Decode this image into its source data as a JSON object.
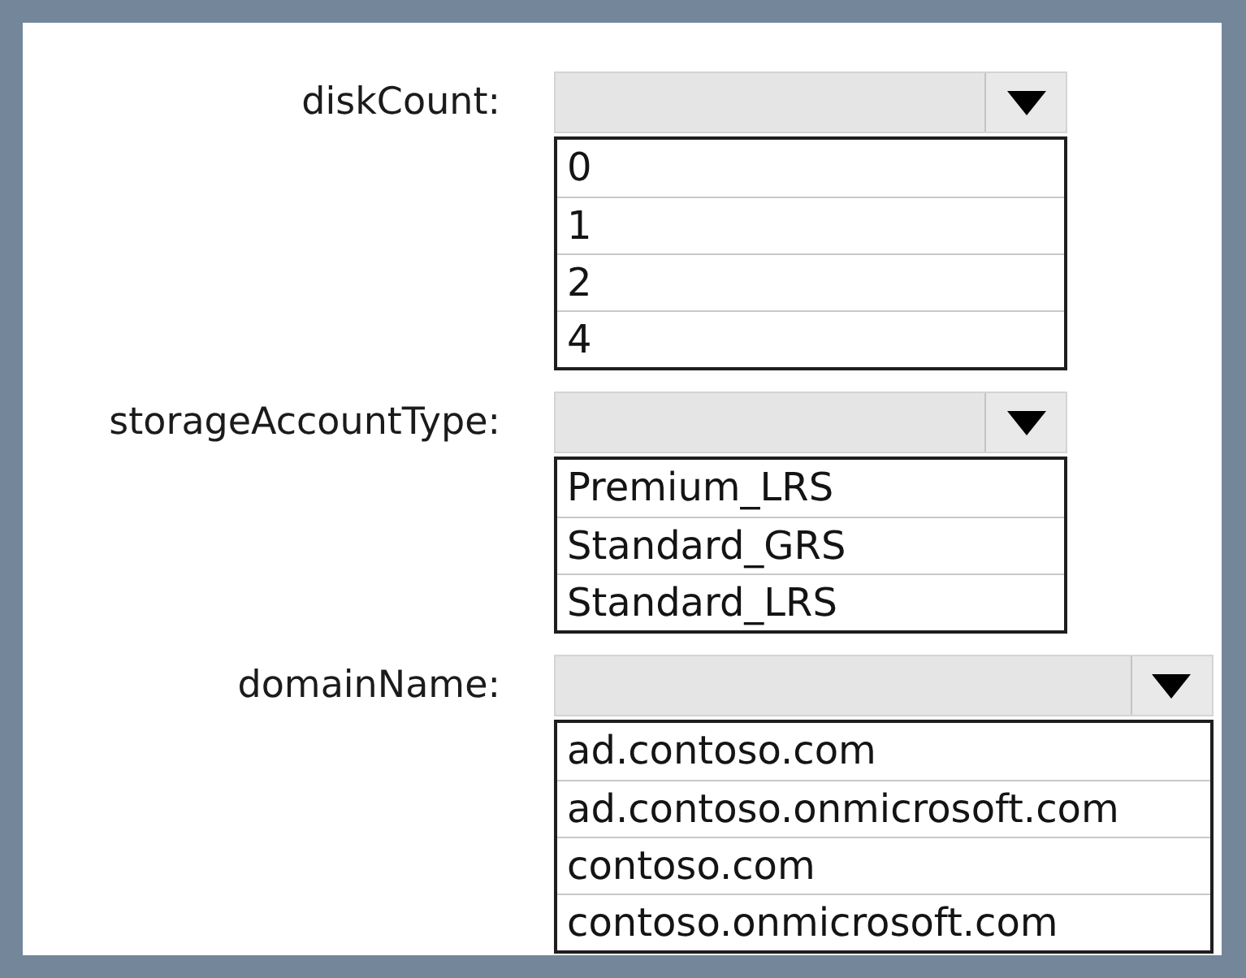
{
  "fields": [
    {
      "label": "diskCount:",
      "expanded": true,
      "options": [
        "0",
        "1",
        "2",
        "4"
      ]
    },
    {
      "label": "storageAccountType:",
      "expanded": true,
      "options": [
        "Premium_LRS",
        "Standard_GRS",
        "Standard_LRS"
      ]
    },
    {
      "label": "domainName:",
      "expanded": true,
      "options": [
        "ad.contoso.com",
        "ad.contoso.onmicrosoft.com",
        "contoso.com",
        "contoso.onmicrosoft.com"
      ]
    }
  ]
}
